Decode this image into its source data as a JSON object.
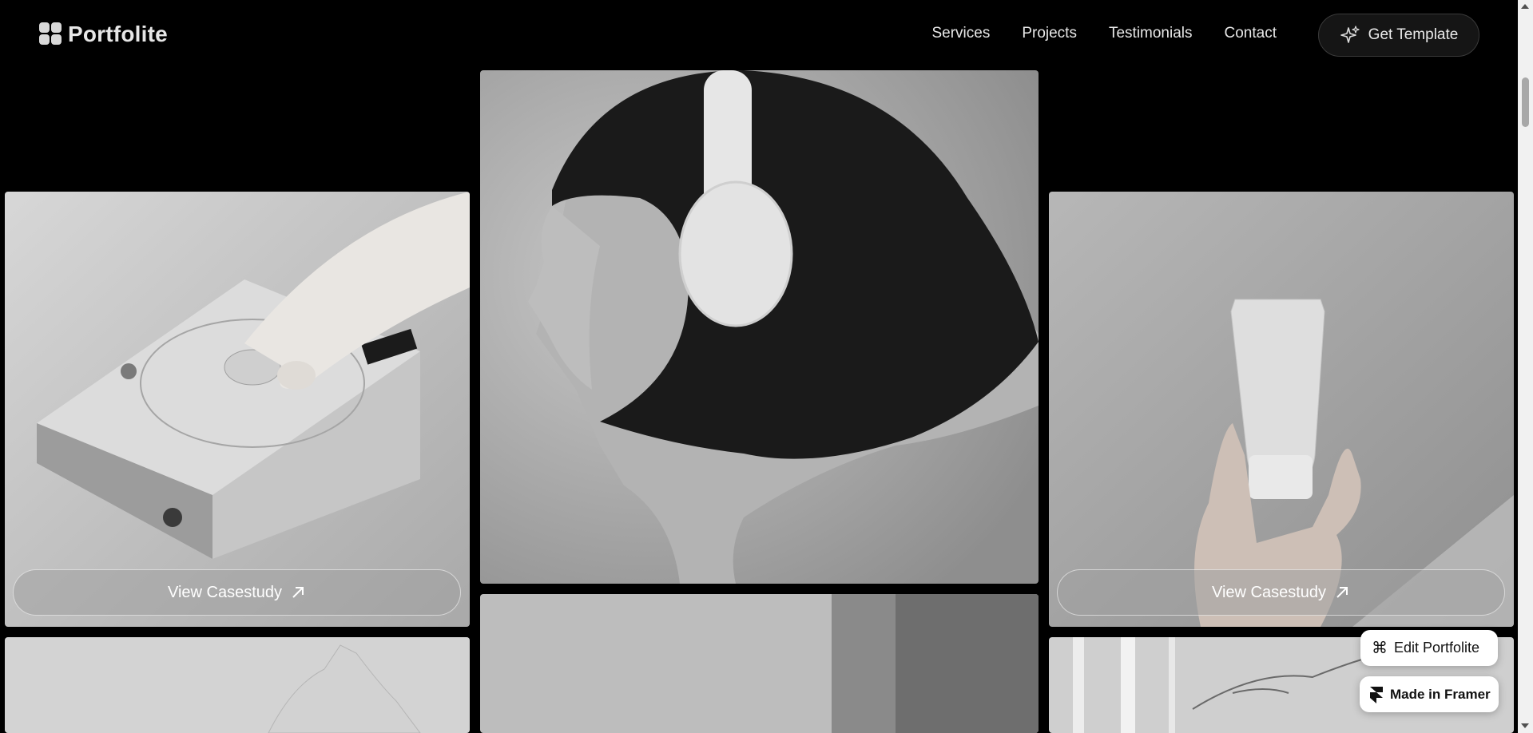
{
  "brand": {
    "name": "Portfolite"
  },
  "nav": {
    "items": [
      "Services",
      "Projects",
      "Testimonials",
      "Contact"
    ],
    "cta_label": "Get Template",
    "cta_icon": "sparkle-icon"
  },
  "cards": {
    "left": {
      "button_label": "View Casestudy",
      "button_icon": "arrow-up-right-icon"
    },
    "right": {
      "button_label": "View Casestudy",
      "button_icon": "arrow-up-right-icon"
    }
  },
  "badges": {
    "edit": {
      "label": "Edit Portfolite",
      "icon": "command-icon"
    },
    "framer": {
      "label": "Made in Framer",
      "icon": "framer-icon"
    }
  },
  "colors": {
    "background": "#000000",
    "button_fill": "#9a9a9a",
    "badge_fill": "#ffffff"
  }
}
